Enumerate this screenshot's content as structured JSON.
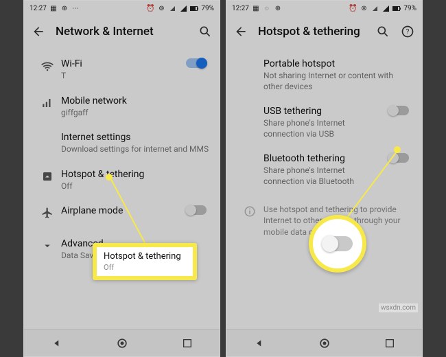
{
  "status": {
    "time": "12:27",
    "battery": "79%"
  },
  "left": {
    "title": "Network & Internet",
    "items": {
      "wifi": {
        "primary": "Wi-Fi",
        "secondary": "T"
      },
      "mobile": {
        "primary": "Mobile network",
        "secondary": "giffgaff"
      },
      "internet": {
        "primary": "Internet settings",
        "secondary": "Download settings for internet and MMS"
      },
      "hotspot": {
        "primary": "Hotspot & tethering",
        "secondary": "Off"
      },
      "airplane": {
        "primary": "Airplane mode"
      },
      "advanced": {
        "primary": "Advanced",
        "secondary": "Data Saver, VPN, Private DNS…"
      }
    },
    "callout": {
      "primary": "Hotspot & tethering",
      "secondary": "Off"
    }
  },
  "right": {
    "title": "Hotspot & tethering",
    "items": {
      "portable": {
        "primary": "Portable hotspot",
        "secondary": "Not sharing Internet or content with other devices"
      },
      "usb": {
        "primary": "USB tethering",
        "secondary": "Share phone's Internet connection via USB"
      },
      "bluetooth": {
        "primary": "Bluetooth tethering",
        "secondary": "Share phone's Internet connection via Bluetooth"
      }
    },
    "info": "Use hotspot and tethering to provide Internet to other devices through your mobile data connection."
  },
  "watermark": "wsxdn.com"
}
